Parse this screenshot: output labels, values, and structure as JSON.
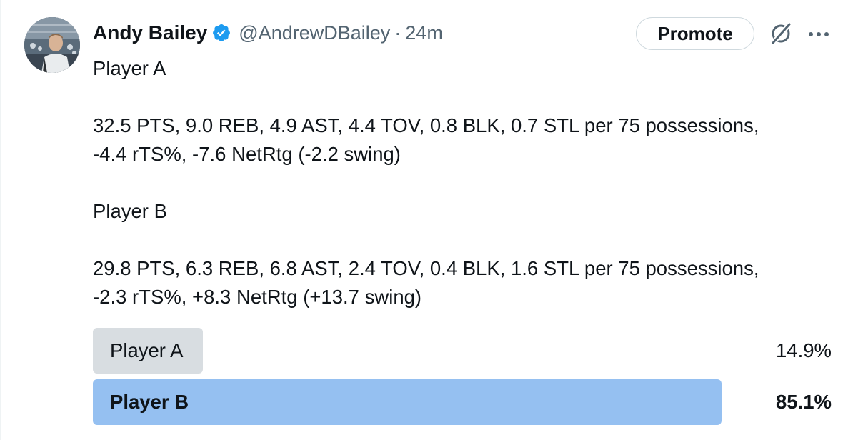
{
  "author": {
    "name": "Andy Bailey",
    "handle": "@AndrewDBailey",
    "separator": "·",
    "time": "24m",
    "verified": true
  },
  "actions": {
    "promote_label": "Promote",
    "grok_icon": "grok-icon",
    "more_icon": "more-icon"
  },
  "tweet": {
    "paragraphs": [
      "Player A",
      "",
      "32.5 PTS, 9.0 REB, 4.9 AST, 4.4 TOV, 0.8 BLK, 0.7 STL per 75 possessions,",
      "-4.4 rTS%, -7.6 NetRtg (-2.2 swing)",
      "",
      "Player B",
      "",
      "29.8 PTS, 6.3 REB, 6.8 AST, 2.4 TOV, 0.4 BLK, 1.6 STL per 75 possessions,",
      "-2.3 rTS%, +8.3 NetRtg (+13.7 swing)"
    ]
  },
  "poll": {
    "options": [
      {
        "label": "Player A",
        "percent_text": "14.9%",
        "fraction": 0.149,
        "winner": false
      },
      {
        "label": "Player B",
        "percent_text": "85.1%",
        "fraction": 0.851,
        "winner": true
      }
    ]
  },
  "colors": {
    "verified_blue": "#1d9bf0",
    "winner_bar": "#95c0f1",
    "loser_bar": "#d8dde1",
    "secondary_text": "#536471"
  }
}
